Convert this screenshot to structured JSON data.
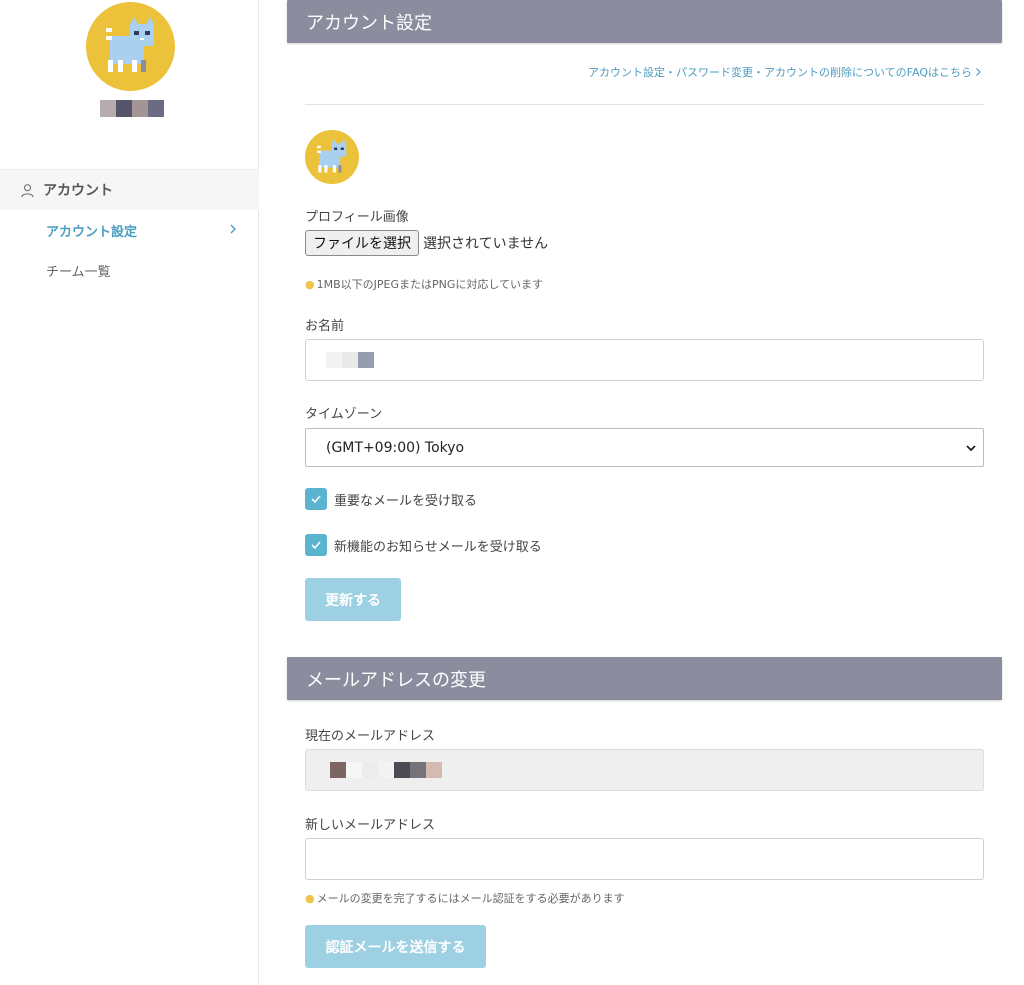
{
  "sidebar": {
    "section_label": "アカウント",
    "items": [
      {
        "label": "アカウント設定",
        "active": true
      },
      {
        "label": "チーム一覧",
        "active": false
      }
    ]
  },
  "account_settings": {
    "header": "アカウント設定",
    "faq_link": "アカウント設定・パスワード変更・アカウントの削除についてのFAQはこちら",
    "profile_image_label": "プロフィール画像",
    "file_button": "ファイルを選択",
    "file_status": "選択されていません",
    "image_hint": "1MB以下のJPEGまたはPNGに対応しています",
    "name_label": "お名前",
    "timezone_label": "タイムゾーン",
    "timezone_value": "(GMT+09:00) Tokyo",
    "checkbox_important": "重要なメールを受け取る",
    "checkbox_features": "新機能のお知らせメールを受け取る",
    "update_button": "更新する"
  },
  "email_change": {
    "header": "メールアドレスの変更",
    "current_label": "現在のメールアドレス",
    "new_label": "新しいメールアドレス",
    "new_value": "",
    "hint": "メールの変更を完了するにはメール認証をする必要があります",
    "send_button": "認証メールを送信する"
  },
  "colors": {
    "accent": "#4a9dc1",
    "header_bg": "#8c8c9f",
    "button_bg": "#9dd0e2",
    "checkbox": "#5ab3cf",
    "avatar_bg": "#ecc23b"
  },
  "icons": {
    "user": "person-outline-icon",
    "chevron": "chevron-right-icon",
    "bulb": "lightbulb-icon",
    "check": "checkmark-icon",
    "caret": "chevron-down-icon"
  }
}
